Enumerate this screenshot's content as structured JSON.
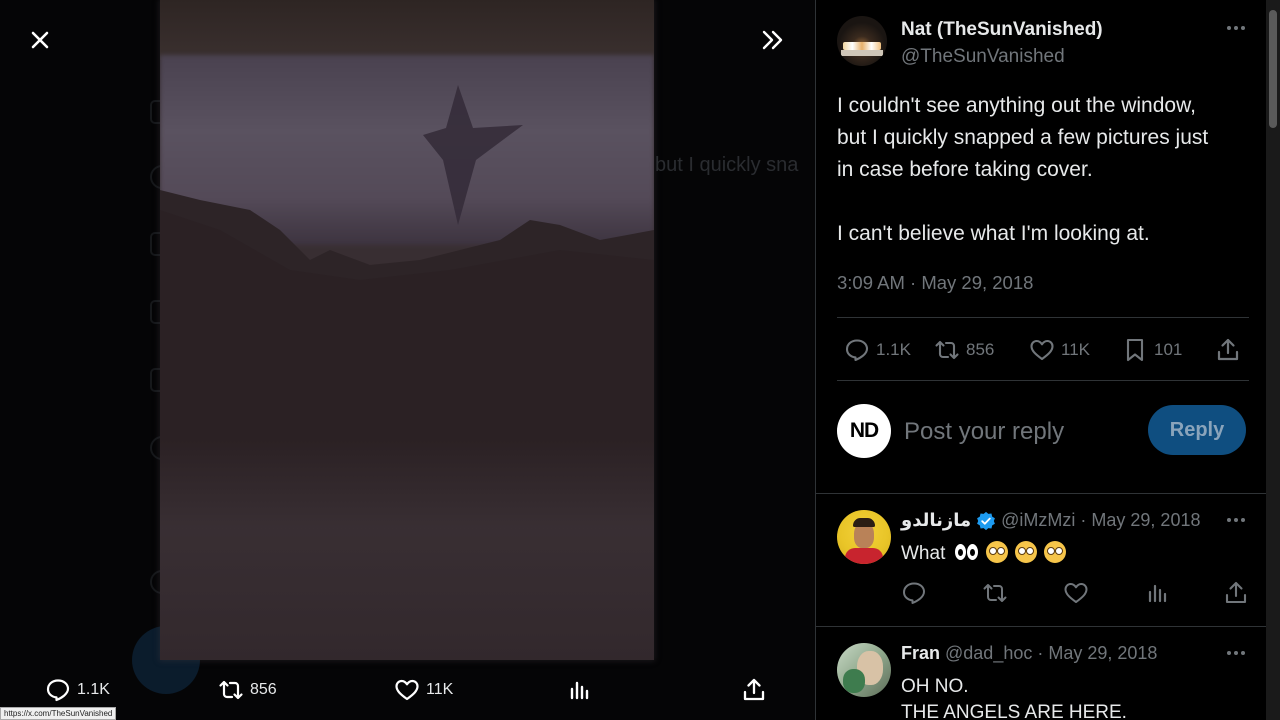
{
  "viewer": {
    "ghost_text": "but I quickly sna",
    "url_tooltip": "https://x.com/TheSunVanished",
    "actions": {
      "replies": "1.1K",
      "retweets": "856",
      "likes": "11K"
    }
  },
  "post": {
    "author_name": "Nat (TheSunVanished)",
    "author_handle": "@TheSunVanished",
    "body_lines": [
      "I couldn't see anything out the window,",
      "but I quickly snapped a few pictures just",
      "in case before taking cover.",
      "I can't believe what I'm looking at."
    ],
    "timestamp": "3:09 AM · May 29, 2018",
    "stats": {
      "replies": "1.1K",
      "retweets": "856",
      "likes": "11K",
      "bookmarks": "101"
    }
  },
  "reply_box": {
    "avatar_initials": "ND",
    "placeholder": "Post your reply",
    "button_label": "Reply"
  },
  "replies": [
    {
      "name": "مازنالدو",
      "handle": "@iMzMzi",
      "date": "· May 29, 2018",
      "text": "What",
      "verified": true
    },
    {
      "name": "Fran",
      "handle": "@dad_hoc",
      "date": "· May 29, 2018",
      "text_lines": [
        "OH NO.",
        "THE ANGELS ARE HERE."
      ],
      "verified": false
    }
  ],
  "colors": {
    "background": "#000000",
    "text_primary": "#e7e9ea",
    "text_secondary": "#71767b",
    "divider": "#2f3336",
    "reply_button": "#0f4e80",
    "verified_badge": "#1d9bf0"
  },
  "icons": [
    "close-icon",
    "chevron-double-right-icon",
    "reply-icon",
    "retweet-icon",
    "like-icon",
    "bookmark-icon",
    "share-icon",
    "views-icon",
    "more-icon",
    "verified-icon"
  ]
}
